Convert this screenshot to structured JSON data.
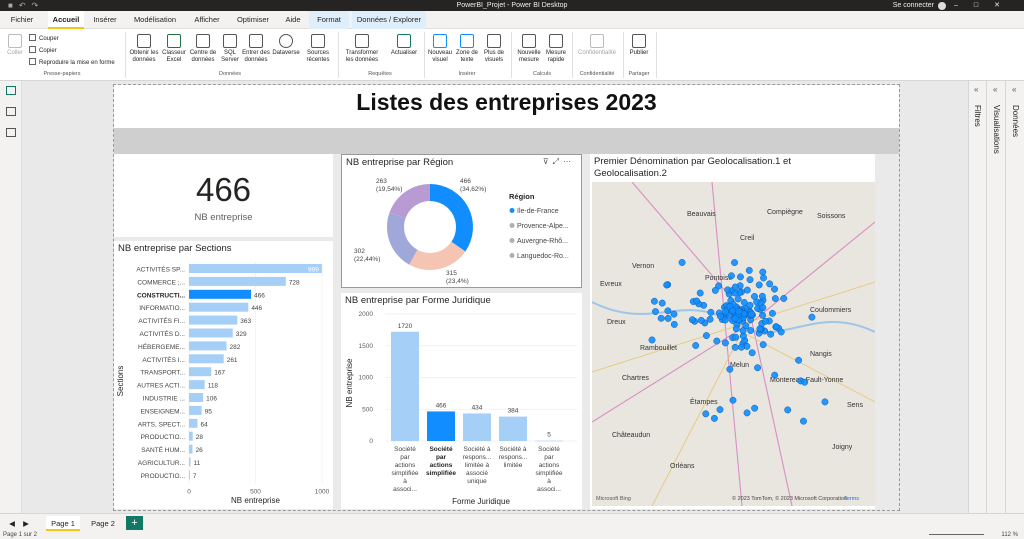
{
  "app": {
    "title": "PowerBI_Projet - Power BI Desktop",
    "signin": "Se connecter"
  },
  "menu": [
    "Fichier",
    "Accueil",
    "Insérer",
    "Modélisation",
    "Afficher",
    "Optimiser",
    "Aide",
    "Format",
    "Données / Explorer"
  ],
  "ribbon": {
    "clipboard": {
      "paste": "Coller",
      "cut": "Couper",
      "copy": "Copier",
      "format_painter": "Reproduire la mise en forme",
      "group": "Presse-papiers"
    },
    "data": {
      "get_data": "Obtenir les données",
      "excel": "Classeur Excel",
      "hub": "Centre de données",
      "sql": "SQL Server",
      "enter": "Entrer des données",
      "dataverse": "Dataverse",
      "recent": "Sources récentes",
      "group": "Données"
    },
    "queries": {
      "transform": "Transformer les données",
      "refresh": "Actualiser",
      "group": "Requêtes"
    },
    "insert": {
      "new_visual": "Nouveau visuel",
      "textbox": "Zone de texte",
      "more_visuals": "Plus de visuels",
      "group": "Insérer"
    },
    "calc": {
      "new_measure": "Nouvelle mesure",
      "quick_measure": "Mesure rapide",
      "group": "Calculs"
    },
    "sensitivity": {
      "label": "Confidentialité",
      "group": "Confidentialité"
    },
    "share": {
      "publish": "Publier",
      "group": "Partager"
    }
  },
  "report": {
    "title": "Listes des entreprises 2023",
    "kpi": {
      "value": "466",
      "label": "NB entreprise"
    },
    "donut": {
      "title": "NB entreprise par Région",
      "legend_title": "Région"
    },
    "sections": {
      "title": "NB entreprise par Sections",
      "xlabel": "NB entreprise",
      "ylabel": "Sections"
    },
    "forme": {
      "title": "NB entreprise par Forme Juridique",
      "xlabel": "Forme Juridique",
      "ylabel": "NB entreprise"
    },
    "map": {
      "title": "Premier Dénomination par Geolocalisation.1 et Geolocalisation.2",
      "copyright": "© 2023 TomTom, © 2023 Microsoft Corporation",
      "terms": "Terms",
      "logo": "Microsoft Bing",
      "places": [
        "Beauvais",
        "Compiègne",
        "Soissons",
        "Creil",
        "Vernon",
        "Pontoise",
        "Evreux",
        "Dreux",
        "Rambouillet",
        "Chartres",
        "Melun",
        "Montereau-Fault-Yonne",
        "Châteaudun",
        "Orléans",
        "Nangis",
        "Coulommiers",
        "Étampes",
        "Joigny",
        "Sens"
      ]
    }
  },
  "chart_data": [
    {
      "type": "pie",
      "title": "NB entreprise par Région",
      "legend_title": "Région",
      "categories": [
        "Ile-de-France",
        "Provence-Alpe...",
        "Auvergne-Rhô...",
        "Languedoc-Ro..."
      ],
      "values": [
        466,
        315,
        302,
        263
      ],
      "data_labels": [
        "466 (34,62%)",
        "315 (23,4%)",
        "302 (22,44%)",
        "263 (19,54%)"
      ],
      "colors": [
        "#118dff",
        "#f5c4b2",
        "#a0a8d9",
        "#b99bd4"
      ]
    },
    {
      "type": "bar",
      "orientation": "horizontal",
      "title": "NB entreprise par Sections",
      "categories": [
        "ACTIVITÉS SP...",
        "COMMERCE ;...",
        "CONSTRUCTI...",
        "INFORMATIO...",
        "ACTIVITÉS FI...",
        "ACTIVITÉS D...",
        "HÉBERGEME...",
        "ACTIVITÉS I...",
        "TRANSPORT...",
        "AUTRES ACTI...",
        "INDUSTRIE ...",
        "ENSEIGNEM...",
        "ARTS, SPECT...",
        "PRODUCTIO...",
        "SANTÉ HUM...",
        "AGRICULTUR...",
        "PRODUCTIO..."
      ],
      "values": [
        999,
        728,
        466,
        446,
        363,
        329,
        282,
        261,
        167,
        118,
        106,
        95,
        64,
        28,
        26,
        11,
        7
      ],
      "highlight_index": 2,
      "xlabel": "NB entreprise",
      "ylabel": "Sections",
      "xticks": [
        0,
        500,
        1000
      ],
      "xlim": [
        0,
        1000
      ]
    },
    {
      "type": "bar",
      "title": "NB entreprise par Forme Juridique",
      "categories": [
        "Société par actions simplifiée à associ...",
        "Société par actions simplifiée",
        "Société à respons... limitée à associé unique",
        "Société à respons... limitée",
        "Société par actions simplifiée à associ..."
      ],
      "values": [
        1720,
        466,
        434,
        384,
        5
      ],
      "highlight_index": 1,
      "xlabel": "Forme Juridique",
      "ylabel": "NB entreprise",
      "yticks": [
        0,
        500,
        1000,
        1500,
        2000
      ],
      "ylim": [
        0,
        2000
      ]
    }
  ],
  "pages": {
    "tabs": [
      "Page 1",
      "Page 2"
    ],
    "add": "+"
  },
  "rightpanes": {
    "filters": "Filtres",
    "visualizations": "Visualisations",
    "data": "Données"
  },
  "status": {
    "page": "Page 1 sur 2",
    "zoom": "112 %"
  },
  "colors": {
    "accent": "#118dff",
    "bar_light": "#a6cff7",
    "brand": "#f2c811",
    "teal": "#117865"
  }
}
